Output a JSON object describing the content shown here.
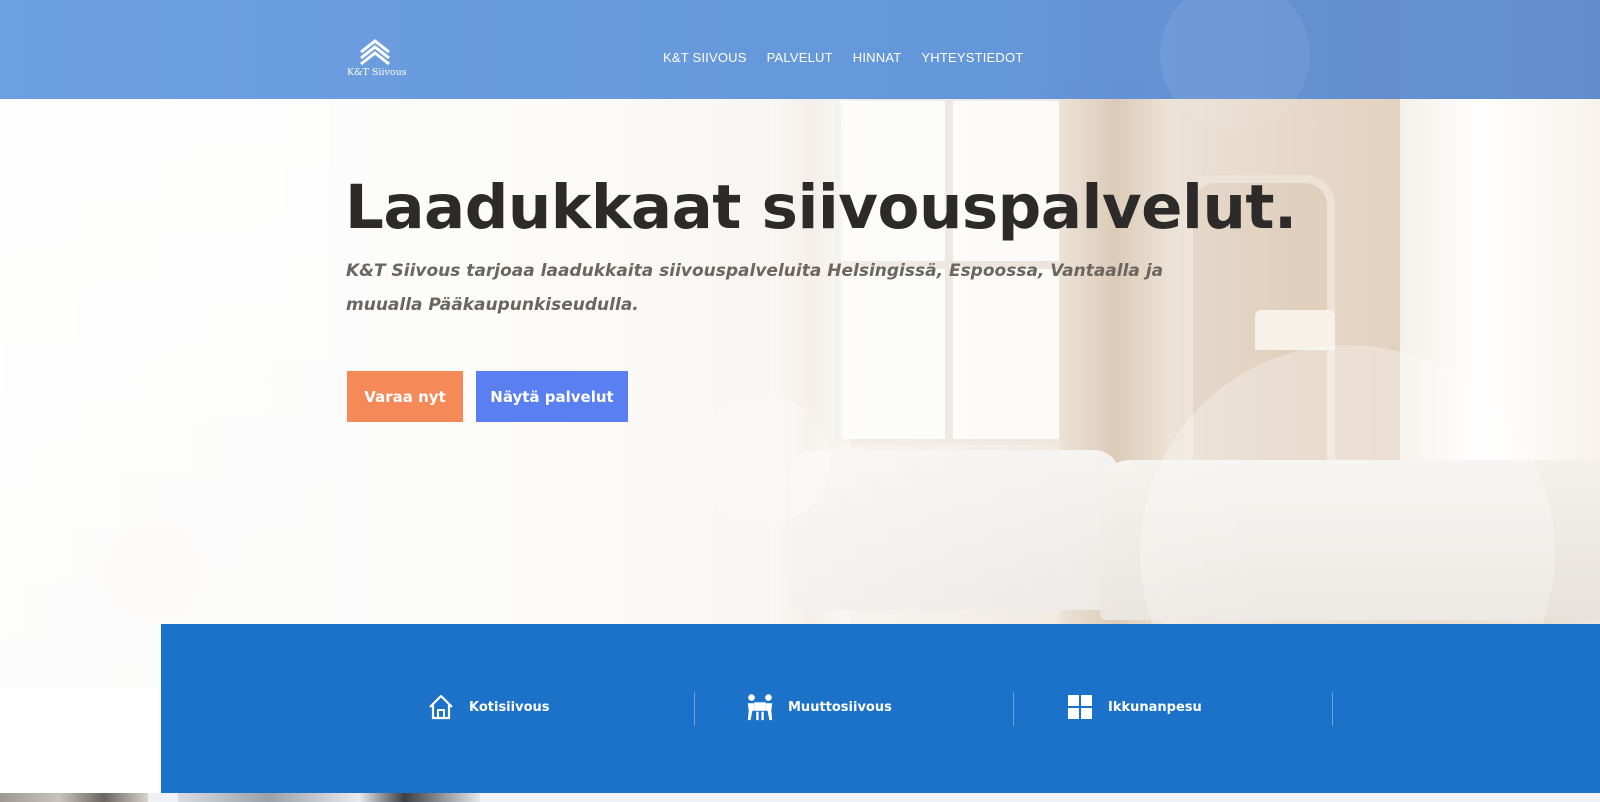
{
  "brand": {
    "logo_text": "K&T Siivous"
  },
  "nav": {
    "items": [
      {
        "label": "K&T SIIVOUS"
      },
      {
        "label": "PALVELUT"
      },
      {
        "label": "HINNAT"
      },
      {
        "label": "YHTEYSTIEDOT"
      }
    ]
  },
  "hero": {
    "title": "Laadukkaat siivouspalvelut.",
    "subtitle": "K&T Siivous  tarjoaa laadukkaita siivouspalveluita Helsingissä, Espoossa, Vantaalla ja muualla Pääkaupunkiseudulla.",
    "primary_button": "Varaa nyt",
    "secondary_button": "Näytä palvelut"
  },
  "services": {
    "items": [
      {
        "label": "Kotisiivous",
        "icon": "house-icon"
      },
      {
        "label": "Muuttosiivous",
        "icon": "movers-icon"
      },
      {
        "label": "Ikkunanpesu",
        "icon": "window-icon"
      }
    ]
  },
  "colors": {
    "header": "#6a9de0",
    "primary_button": "#f58957",
    "secondary_button": "#5a7ff0",
    "service_bar": "#1b72c8",
    "title": "#2c2b2a",
    "subtitle": "#6c6661"
  }
}
